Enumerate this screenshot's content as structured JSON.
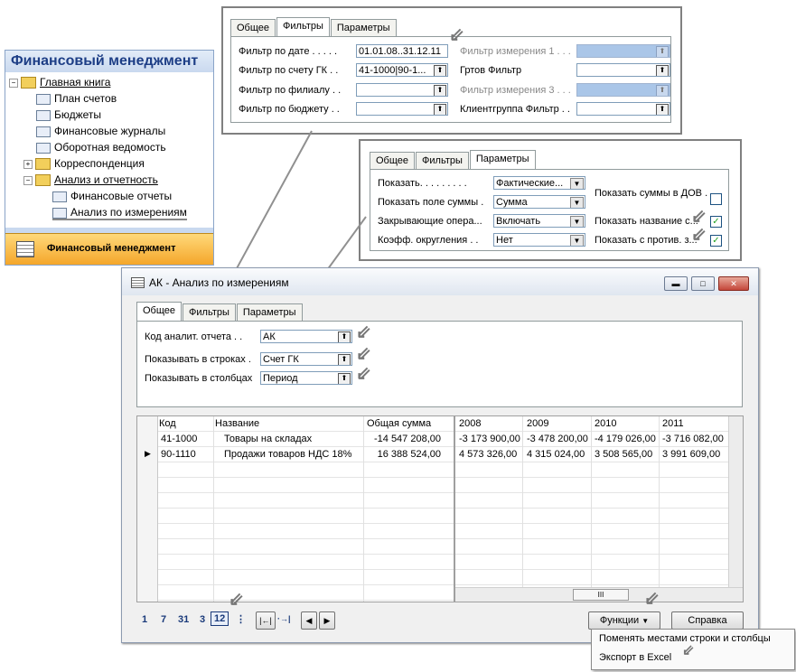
{
  "nav_pane": {
    "title": "Финансовый менеджмент",
    "items": [
      {
        "label": "Главная книга"
      },
      {
        "label": "План счетов"
      },
      {
        "label": "Бюджеты"
      },
      {
        "label": "Финансовые журналы"
      },
      {
        "label": "Оборотная ведомость"
      },
      {
        "label": "Корреспонденция"
      },
      {
        "label": "Анализ и отчетность"
      },
      {
        "label": "Финансовые отчеты"
      },
      {
        "label": "Анализ по измерениям"
      }
    ],
    "footer_label": "Финансовый менеджмент",
    "expand_minus": "−",
    "expand_plus": "+"
  },
  "filters_panel": {
    "tabs": [
      "Общее",
      "Фильтры",
      "Параметры"
    ],
    "fields": [
      {
        "label": "Фильтр по дате . . . . .",
        "value": "01.01.08..31.12.11"
      },
      {
        "label": "Фильтр по счету ГК . .",
        "value": "41-1000|90-1..."
      },
      {
        "label": "Фильтр по филиалу . .",
        "value": ""
      },
      {
        "label": "Фильтр по бюджету . .",
        "value": ""
      }
    ],
    "right_fields": [
      {
        "label": "Фильтр измерения 1 . . .",
        "value": ""
      },
      {
        "label": "Гртов Фильтр",
        "value": ""
      },
      {
        "label": "Фильтр измерения 3 . . .",
        "value": ""
      },
      {
        "label": "Клиентгруппа Фильтр . .",
        "value": ""
      }
    ]
  },
  "params_panel": {
    "tabs": [
      "Общее",
      "Фильтры",
      "Параметры"
    ],
    "fields": [
      {
        "label": "Показать. . . . . . . . .",
        "value": "Фактические..."
      },
      {
        "label": "Показать поле суммы .",
        "value": "Сумма"
      },
      {
        "label": "Закрывающие опера...",
        "value": "Включать"
      },
      {
        "label": "Коэфф. округления . .",
        "value": "Нет"
      }
    ],
    "checks": [
      {
        "label": "Показать суммы в ДОВ .",
        "checked": ""
      },
      {
        "label": "Показать название с...",
        "checked": "✓"
      },
      {
        "label": "Показать с против. з...",
        "checked": "✓"
      }
    ]
  },
  "window": {
    "title": "АК - Анализ по измерениям",
    "controls": {
      "minimize": "▬",
      "maximize": "□",
      "close": "✕"
    },
    "tabs": [
      "Общее",
      "Фильтры",
      "Параметры"
    ],
    "fields": [
      {
        "label": "Код аналит. отчета . .",
        "value": "АК"
      },
      {
        "label": "Показывать в строках .",
        "value": "Счет ГК"
      },
      {
        "label": "Показывать в столбцах",
        "value": "Период"
      }
    ],
    "left_grid": {
      "headers": [
        "Код",
        "Название",
        "Общая сумма"
      ],
      "rows": [
        {
          "code": "41-1000",
          "name": "Товары на складах",
          "total": "-14 547 208,00"
        },
        {
          "code": "90-1110",
          "name": "Продажи товаров НДС 18%",
          "total": "16 388 524,00"
        }
      ]
    },
    "right_grid": {
      "headers": [
        "2008",
        "2009",
        "2010",
        "2011"
      ],
      "rows": [
        [
          "-3 173 900,00",
          "-3 478 200,00",
          "-4 179 026,00",
          "-3 716 082,00"
        ],
        [
          "4 573 326,00",
          "4 315 024,00",
          "3 508 565,00",
          "3 991 609,00"
        ]
      ]
    },
    "row_pointer": "▶",
    "scroll_thumb": "III",
    "period_buttons": [
      "1",
      "7",
      "31",
      "3",
      "12",
      "⋮"
    ],
    "nav_buttons": {
      "first_last": "|←|",
      "range": "·→|",
      "prev": "◀",
      "next": "▶"
    },
    "functions_button": "Функции",
    "help_button": "Справка"
  },
  "context_menu": {
    "items": [
      "Поменять местами строки и столбцы",
      "Экспорт в Excel"
    ]
  },
  "glyphs": {
    "lookup": "⬆",
    "dropdown": "▼",
    "arrow": "⇙"
  }
}
